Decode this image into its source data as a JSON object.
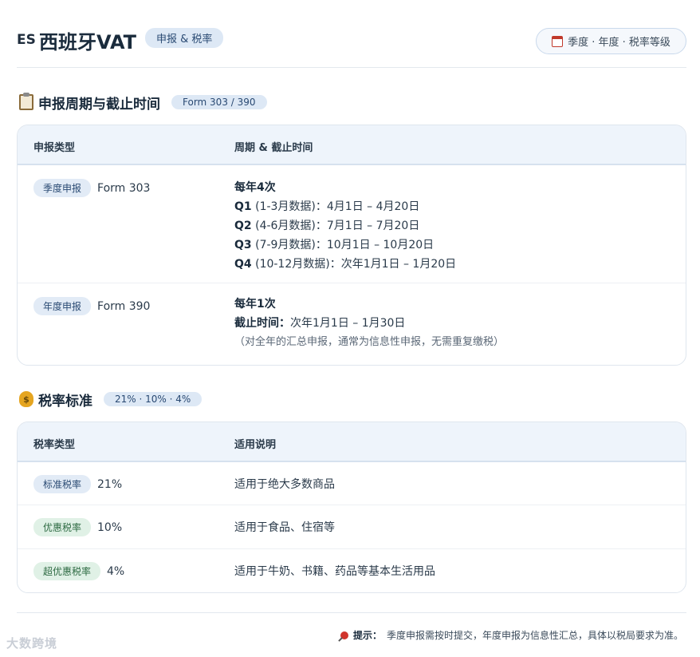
{
  "header": {
    "flag": "ES",
    "title": "西班牙VAT",
    "badge": "申报 & 税率",
    "top_right": "季度 · 年度 · 税率等级"
  },
  "filing": {
    "title": "申报周期与截止时间",
    "badge": "Form 303 / 390",
    "col_type": "申报类型",
    "col_period": "周期 & 截止时间",
    "rows": [
      {
        "tag": "季度申报",
        "form": "Form 303",
        "head": "每年4次",
        "lines": [
          {
            "q": "Q1",
            "text": " (1-3月数据)：4月1日 – 4月20日"
          },
          {
            "q": "Q2",
            "text": " (4-6月数据)：7月1日 – 7月20日"
          },
          {
            "q": "Q3",
            "text": " (7-9月数据)：10月1日 – 10月20日"
          },
          {
            "q": "Q4",
            "text": " (10-12月数据)：次年1月1日 – 1月20日"
          }
        ]
      },
      {
        "tag": "年度申报",
        "form": "Form 390",
        "head": "每年1次",
        "deadline_label": "截止时间：",
        "deadline": "次年1月1日 – 1月30日",
        "note": "（对全年的汇总申报，通常为信息性申报，无需重复缴税）"
      }
    ]
  },
  "rates": {
    "title": "税率标准",
    "badge": "21% · 10% · 4%",
    "col_type": "税率类型",
    "col_desc": "适用说明",
    "rows": [
      {
        "tag": "标准税率",
        "value": "21%",
        "desc": "适用于绝大多数商品"
      },
      {
        "tag": "优惠税率",
        "value": "10%",
        "desc": "适用于食品、住宿等"
      },
      {
        "tag": "超优惠税率",
        "value": "4%",
        "desc": "适用于牛奶、书籍、药品等基本生活用品"
      }
    ]
  },
  "tip": {
    "label": "提示：",
    "text": "季度申报需按时提交，年度申报为信息性汇总，具体以税局要求为准。"
  },
  "watermark": "大数跨境"
}
